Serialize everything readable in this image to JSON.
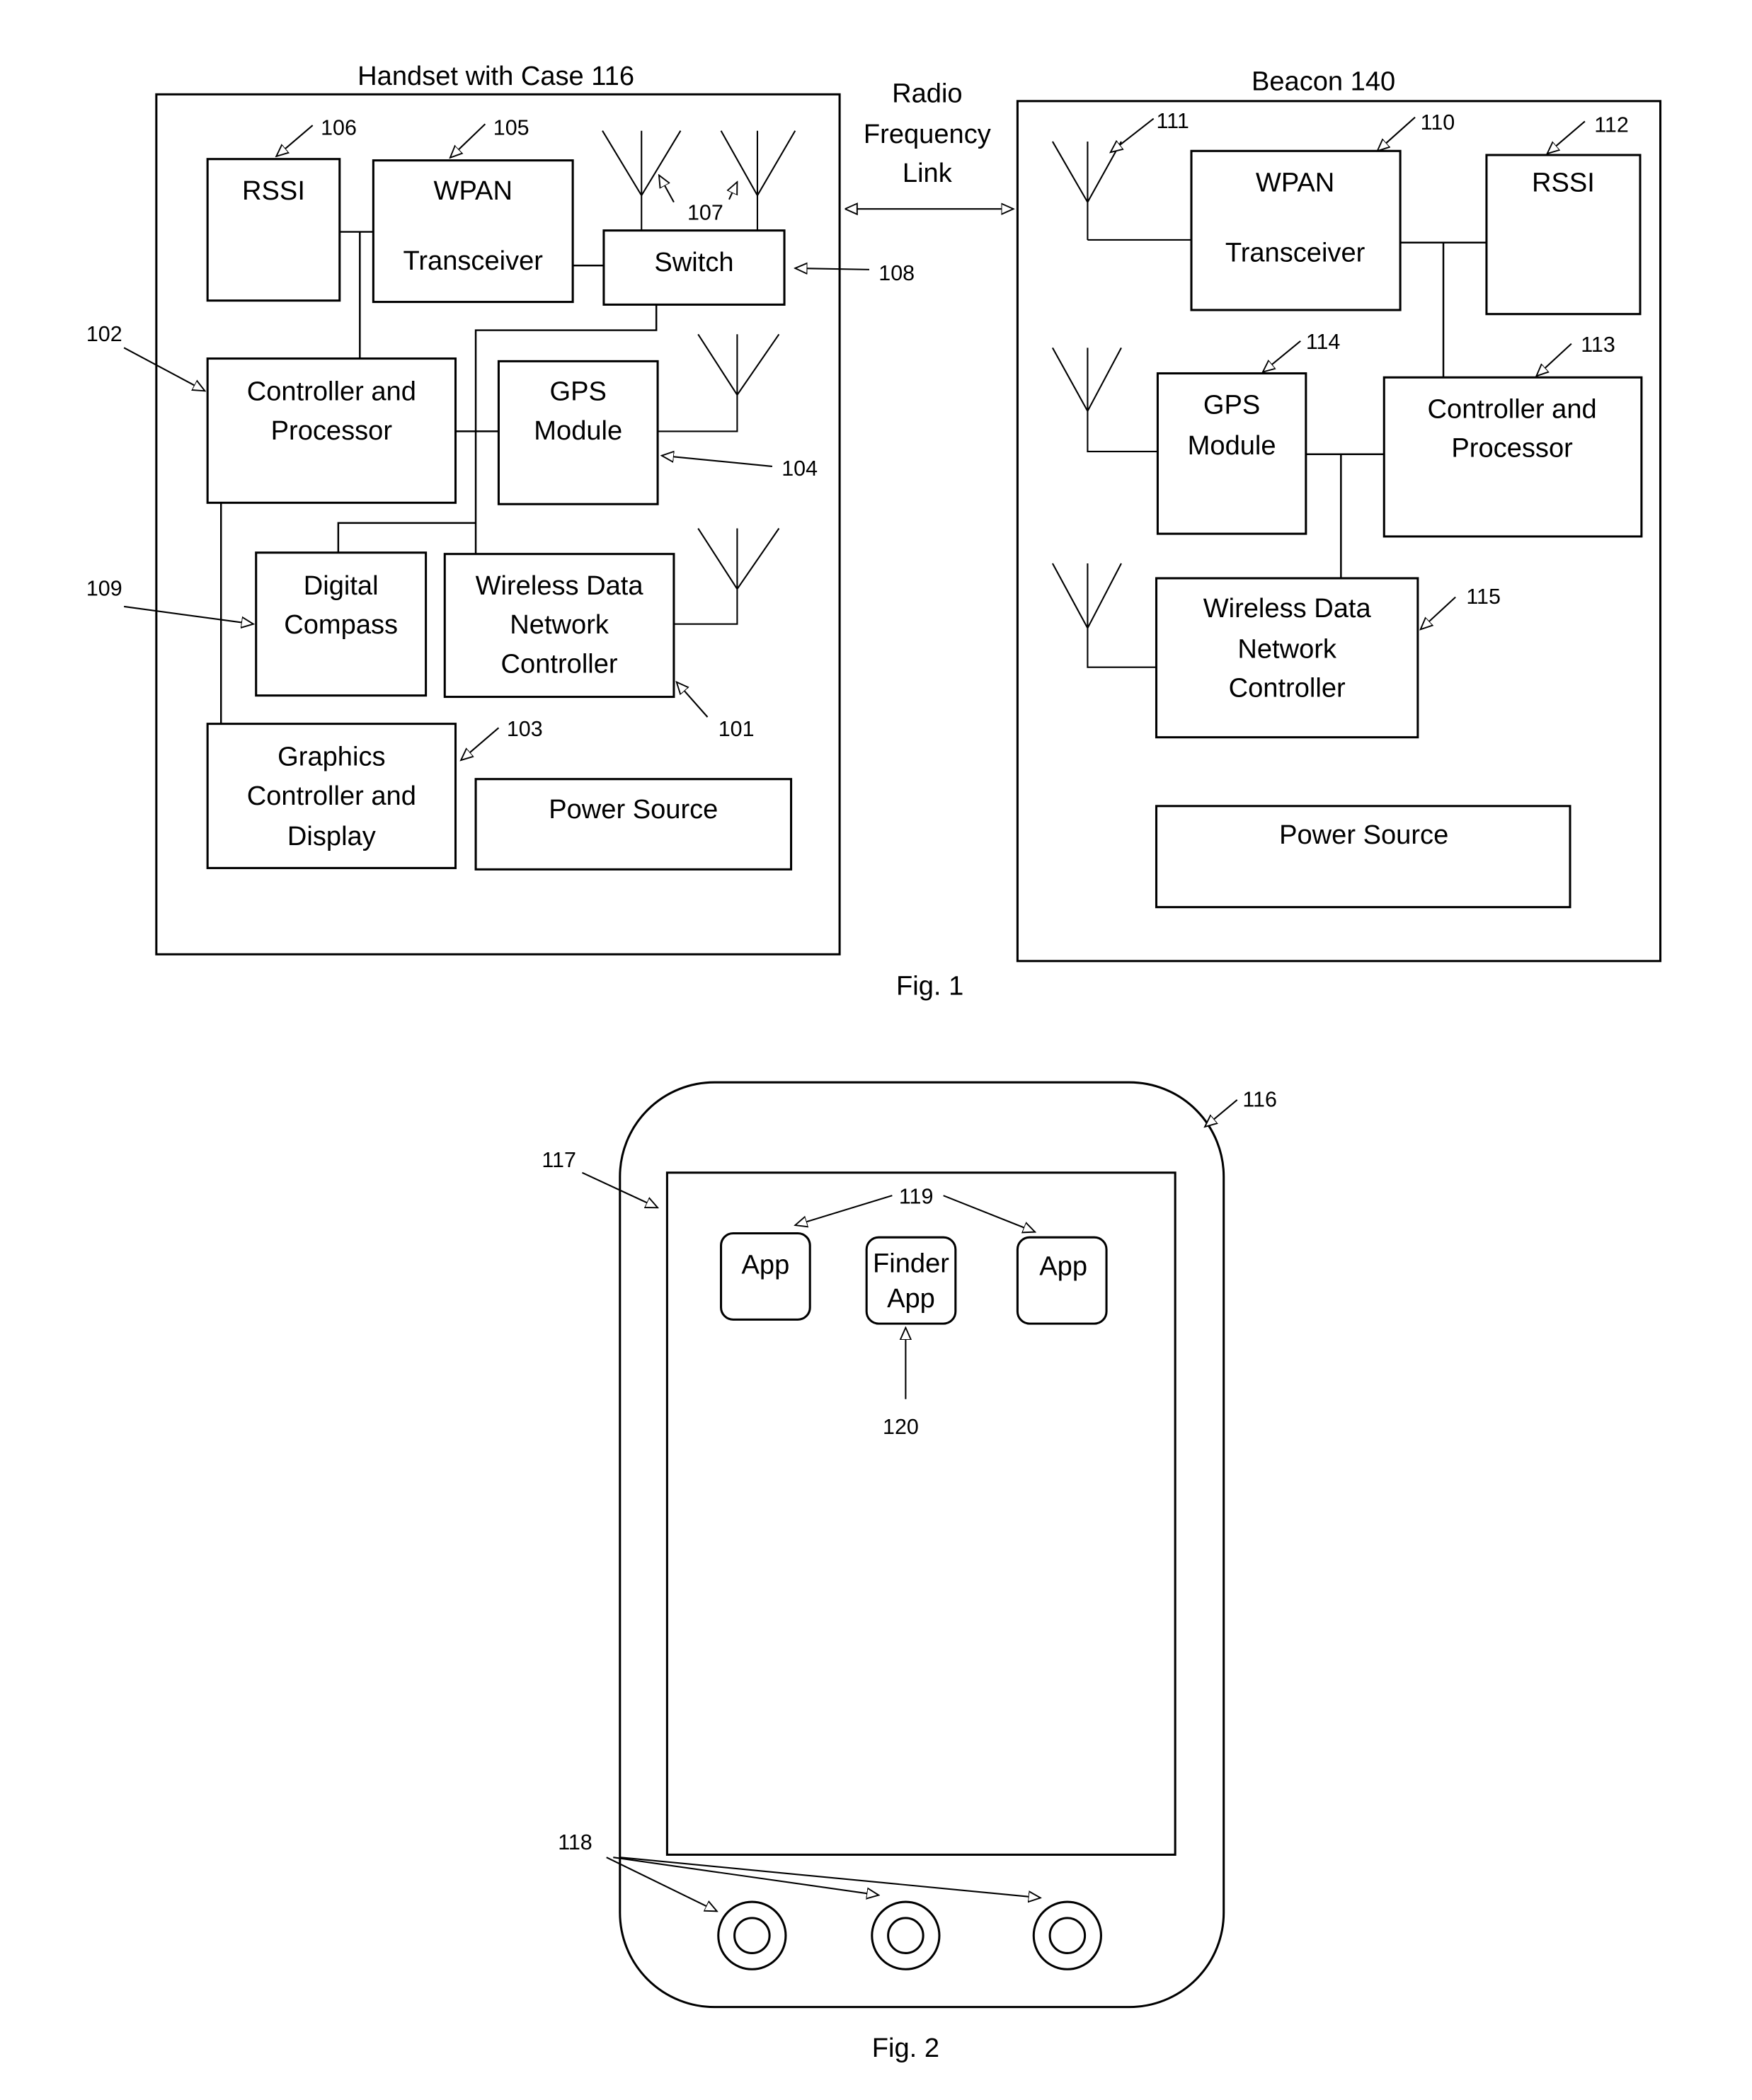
{
  "figure1": {
    "caption": "Fig. 1",
    "link_label": [
      "Radio",
      "Frequency",
      "Link"
    ],
    "handset": {
      "title": "Handset with Case 116",
      "blocks": {
        "rssi": {
          "lines": [
            "RSSI"
          ],
          "ref": "106"
        },
        "wpan": {
          "lines": [
            "WPAN",
            "Transceiver"
          ],
          "ref": "105"
        },
        "switch": {
          "lines": [
            "Switch"
          ],
          "ref": "108"
        },
        "controller": {
          "lines": [
            "Controller and",
            "Processor"
          ],
          "ref": "102"
        },
        "gps": {
          "lines": [
            "GPS",
            "Module"
          ],
          "ref": "104"
        },
        "compass": {
          "lines": [
            "Digital",
            "Compass"
          ],
          "ref": "109"
        },
        "wdnc": {
          "lines": [
            "Wireless Data",
            "Network",
            "Controller"
          ],
          "ref": "101"
        },
        "graphics": {
          "lines": [
            "Graphics",
            "Controller and",
            "Display"
          ],
          "ref": "103"
        },
        "power": {
          "lines": [
            "Power Source"
          ]
        }
      },
      "antenna_ref": "107"
    },
    "beacon": {
      "title": "Beacon 140",
      "blocks": {
        "wpan": {
          "lines": [
            "WPAN",
            "Transceiver"
          ],
          "ref": "110"
        },
        "rssi": {
          "lines": [
            "RSSI"
          ],
          "ref": "112"
        },
        "gps": {
          "lines": [
            "GPS",
            "Module"
          ],
          "ref": "114"
        },
        "controller": {
          "lines": [
            "Controller and",
            "Processor"
          ],
          "ref": "113"
        },
        "wdnc": {
          "lines": [
            "Wireless Data",
            "Network",
            "Controller"
          ],
          "ref": "115"
        },
        "power": {
          "lines": [
            "Power Source"
          ]
        }
      },
      "antenna_ref": "111"
    }
  },
  "figure2": {
    "caption": "Fig. 2",
    "case_ref": "116",
    "screen_ref": "117",
    "buttons_ref": "118",
    "apps_ref": "119",
    "finder_ref": "120",
    "apps": [
      {
        "lines": [
          "App"
        ]
      },
      {
        "lines": [
          "Finder",
          "App"
        ]
      },
      {
        "lines": [
          "App"
        ]
      }
    ]
  }
}
